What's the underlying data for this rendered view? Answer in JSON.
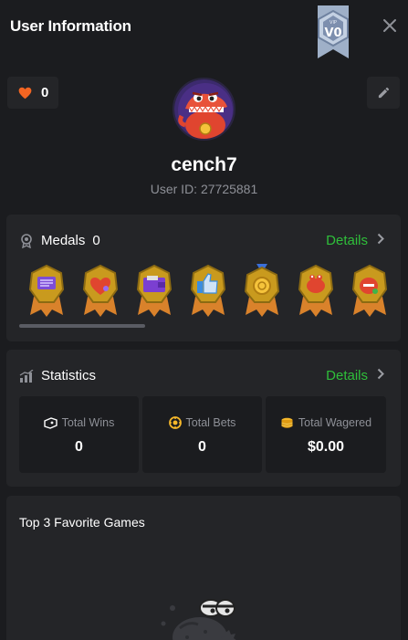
{
  "header": {
    "title": "User Information",
    "vip_label": "V0",
    "vip_tag": "VIP"
  },
  "likes": {
    "count": "0"
  },
  "profile": {
    "username": "cench7",
    "user_id": "User ID: 27725881"
  },
  "medals": {
    "title": "Medals",
    "count": "0",
    "details": "Details"
  },
  "statistics": {
    "title": "Statistics",
    "details": "Details",
    "items": [
      {
        "label": "Total Wins",
        "value": "0"
      },
      {
        "label": "Total Bets",
        "value": "0"
      },
      {
        "label": "Total Wagered",
        "value": "$0.00"
      }
    ]
  },
  "favorites": {
    "title": "Top 3 Favorite Games"
  },
  "colors": {
    "accent_green": "#2fbf3a",
    "heart": "#f26522",
    "gold": "#c99a1e",
    "background": "#1b1c1f",
    "card": "#242528"
  }
}
